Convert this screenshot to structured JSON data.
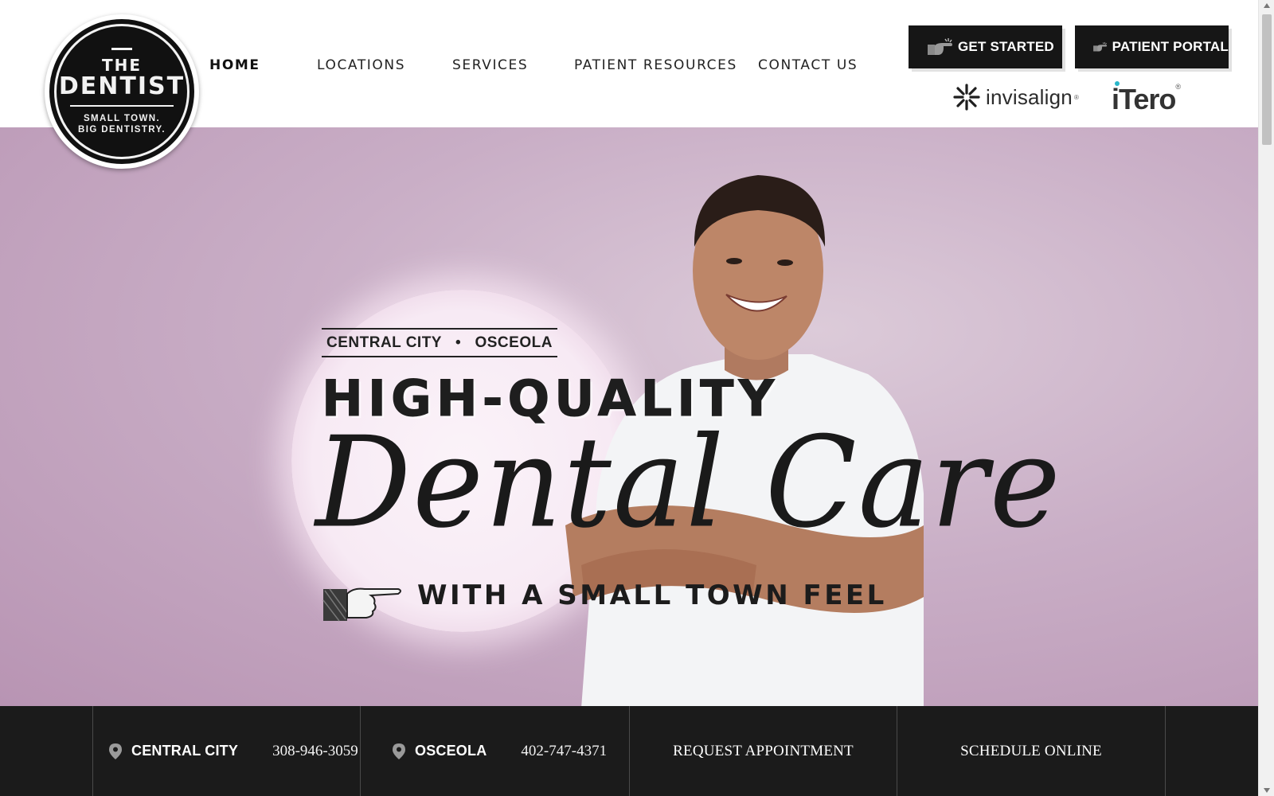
{
  "logo": {
    "line1": "THE",
    "line2": "DENTIST",
    "tagline1": "SMALL TOWN.",
    "tagline2": "BIG DENTISTRY."
  },
  "nav": {
    "items": [
      {
        "label": "HOME",
        "active": true
      },
      {
        "label": "LOCATIONS",
        "active": false
      },
      {
        "label": "SERVICES",
        "active": false
      },
      {
        "label": "PATIENT RESOURCES",
        "active": false
      },
      {
        "label": "CONTACT US",
        "active": false
      }
    ]
  },
  "header_buttons": {
    "get_started": {
      "label": "GET STARTED",
      "icon": "pointing-hand-icon"
    },
    "patient_portal": {
      "label": "PATIENT PORTAL",
      "icon": "pointing-hand-icon"
    }
  },
  "partners": {
    "invisalign": {
      "word": "invisalign",
      "mark": "®",
      "icon": "invisalign-star-icon"
    },
    "itero": {
      "word": "iTero",
      "mark": "®"
    }
  },
  "hero": {
    "town1": "CENTRAL CITY",
    "separator": "•",
    "town2": "OSCEOLA",
    "headline": "HIGH-QUALITY",
    "script": "Dental Care",
    "subline": "WITH A SMALL TOWN FEEL",
    "pointer_icon": "pointing-hand-icon",
    "background_color": "#c6a8c2"
  },
  "bottom_bar": {
    "locations": [
      {
        "city": "CENTRAL CITY",
        "phone": "308-946-3059",
        "icon": "map-pin-icon"
      },
      {
        "city": "OSCEOLA",
        "phone": "402-747-4371",
        "icon": "map-pin-icon"
      }
    ],
    "request_appointment": "REQUEST APPOINTMENT",
    "schedule_online": "SCHEDULE ONLINE",
    "background_color": "#1b1b1b"
  }
}
